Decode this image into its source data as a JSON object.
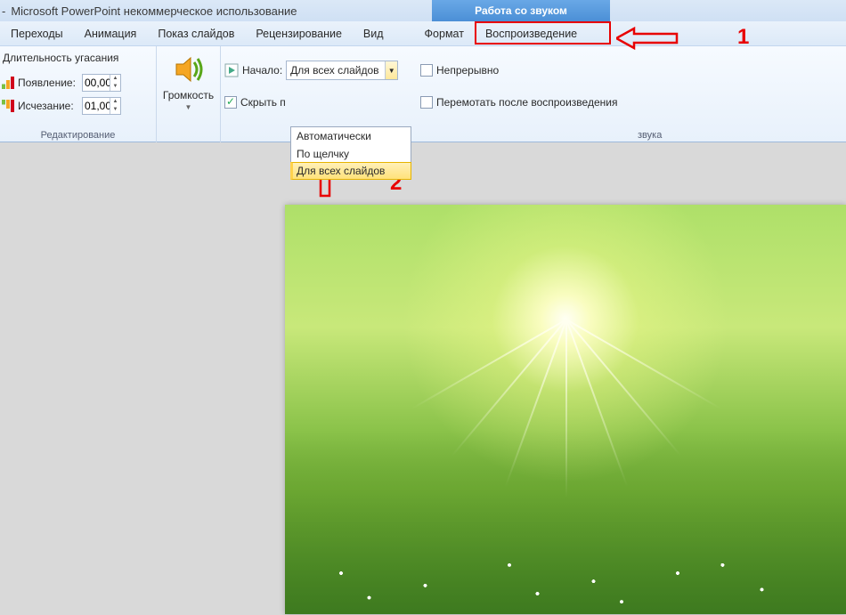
{
  "titlebar": {
    "dash": "-",
    "app_title": "Microsoft PowerPoint некоммерческое использование",
    "context_tab": "Работа со звуком"
  },
  "tabs": {
    "transitions": "Переходы",
    "animation": "Анимация",
    "slideshow": "Показ слайдов",
    "review": "Рецензирование",
    "view": "Вид",
    "format": "Формат",
    "playback": "Воспроизведение"
  },
  "ribbon": {
    "fade_title": "Длительность угасания",
    "fade_in_label": "Появление:",
    "fade_in_value": "00,00",
    "fade_out_label": "Исчезание:",
    "fade_out_value": "01,00",
    "group1_label": "Редактирование",
    "volume_label": "Громкость",
    "hide_label": "Скрыть п",
    "start_label": "Начало:",
    "start_value": "Для всех слайдов",
    "loop_label": "Непрерывно",
    "rewind_label": "Перемотать после воспроизведения",
    "group2_label": "звука"
  },
  "dropdown": {
    "opt1": "Автоматически",
    "opt2": "По щелчку",
    "opt3": "Для всех слайдов"
  },
  "annot": {
    "one": "1",
    "two": "2"
  }
}
